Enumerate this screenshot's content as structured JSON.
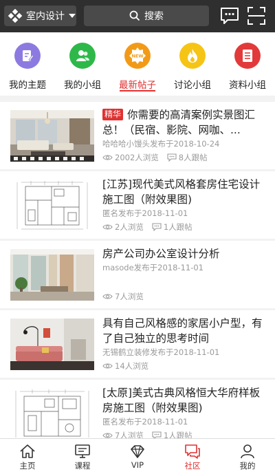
{
  "topbar": {
    "category": "室内设计",
    "search_placeholder": "搜索"
  },
  "nav": {
    "items": [
      {
        "label": "我的主题",
        "color": "#8d7ae0"
      },
      {
        "label": "我的小组",
        "color": "#2fb84a"
      },
      {
        "label": "最新帖子",
        "color": "#f29a18",
        "badge": "NEW"
      },
      {
        "label": "讨论小组",
        "color": "#f6c415"
      },
      {
        "label": "资料小组",
        "color": "#e23a3a"
      }
    ],
    "active_index": 2,
    "accent": "#e03131"
  },
  "posts": [
    {
      "tag": "精华",
      "title": "你需要的高清案例实景图汇总！（民宿、影院、网咖、...",
      "meta": "哈哈哈小馒头发布于2018-10-24",
      "views": "2002人浏览",
      "followers": "8人跟帖",
      "thumb": "living-room-photo"
    },
    {
      "tag": "",
      "title": "[江苏]现代美式风格套房住宅设计施工图（附效果图)",
      "meta": "匿名发布于2018-11-01",
      "views": "2人浏览",
      "followers": "1人跟帖",
      "thumb": "floor-plan-drawing"
    },
    {
      "tag": "",
      "title": "房产公司办公室设计分析",
      "meta": "masode发布于2018-11-01",
      "views": "7人浏览",
      "followers": "",
      "thumb": "office-photo"
    },
    {
      "tag": "",
      "title": "具有自己风格感的家居小户型，有了自己独立的思考时间",
      "meta": "无锡鹤立装修发布于2018-11-01",
      "views": "14人浏览",
      "followers": "",
      "thumb": "home-sofa-photo"
    },
    {
      "tag": "",
      "title": "[太原]美式古典风格恒大华府样板房施工图（附效果图)",
      "meta": "匿名发布于2018-11-01",
      "views": "7人浏览",
      "followers": "1人跟帖",
      "thumb": "floor-plan-drawing"
    }
  ],
  "tabs": [
    {
      "label": "主页",
      "icon": "home-icon"
    },
    {
      "label": "课程",
      "icon": "course-icon"
    },
    {
      "label": "VIP",
      "icon": "vip-icon"
    },
    {
      "label": "社区",
      "icon": "community-icon"
    },
    {
      "label": "我的",
      "icon": "user-icon"
    }
  ],
  "active_tab": 3
}
